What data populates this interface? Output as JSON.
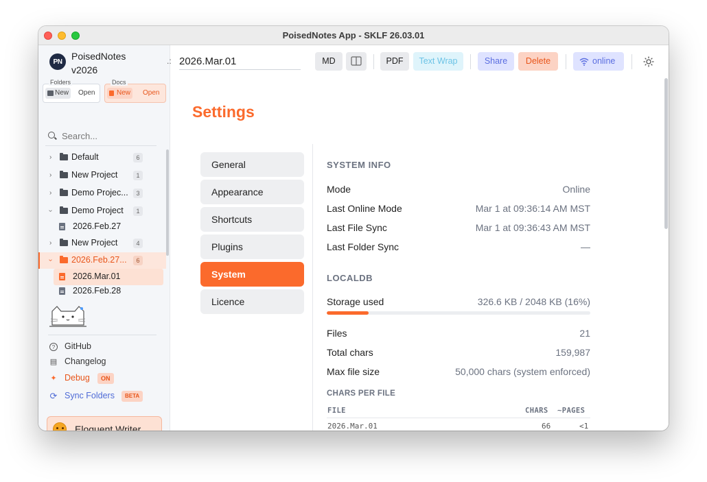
{
  "window": {
    "title": "PoisedNotes App - SKLF 26.03.01"
  },
  "app": {
    "logo": "PN",
    "name": "PoisedNotes",
    "version": "v2026"
  },
  "sidebar": {
    "folders_group": {
      "label": "Folders",
      "new": "New",
      "open": "Open"
    },
    "docs_group": {
      "label": "Docs",
      "new": "New",
      "open": "Open"
    },
    "search_placeholder": "Search...",
    "tree": [
      {
        "type": "folder",
        "label": "Default",
        "count": "6",
        "expanded": false
      },
      {
        "type": "folder",
        "label": "New Project",
        "count": "1",
        "expanded": false
      },
      {
        "type": "folder",
        "label": "Demo Projec...",
        "count": "3",
        "expanded": false
      },
      {
        "type": "folder",
        "label": "Demo Project",
        "count": "1",
        "expanded": true
      },
      {
        "type": "file",
        "label": "2026.Feb.27"
      },
      {
        "type": "folder",
        "label": "New Project",
        "count": "4",
        "expanded": false
      },
      {
        "type": "folder",
        "label": "2026.Feb.27...",
        "count": "6",
        "expanded": true,
        "active": true
      },
      {
        "type": "file",
        "label": "2026.Mar.01",
        "active": true
      },
      {
        "type": "file",
        "label": "2026.Feb.28"
      }
    ],
    "links": {
      "github": "GitHub",
      "changelog": "Changelog",
      "debug": "Debug",
      "debug_badge": "ON",
      "sync": "Sync Folders",
      "sync_badge": "BETA"
    },
    "writer": "Eloquent Writer..."
  },
  "toolbar": {
    "doc_title": "2026.Mar.01",
    "md": "MD",
    "pdf": "PDF",
    "text_wrap": "Text Wrap",
    "share": "Share",
    "delete": "Delete",
    "online": "online"
  },
  "settings": {
    "heading": "Settings",
    "menu": [
      "General",
      "Appearance",
      "Shortcuts",
      "Plugins",
      "System",
      "Licence"
    ],
    "active_menu": "System",
    "system_info": {
      "heading": "SYSTEM INFO",
      "rows": [
        {
          "k": "Mode",
          "v": "Online"
        },
        {
          "k": "Last Online Mode",
          "v": "Mar 1 at 09:36:14 AM MST"
        },
        {
          "k": "Last File Sync",
          "v": "Mar 1 at 09:36:43 AM MST"
        },
        {
          "k": "Last Folder Sync",
          "v": "—"
        }
      ]
    },
    "localdb": {
      "heading": "LOCALDB",
      "storage_label": "Storage used",
      "storage_value": "326.6 KB / 2048 KB (16%)",
      "storage_fraction": 0.16,
      "rows": [
        {
          "k": "Files",
          "v": "21"
        },
        {
          "k": "Total chars",
          "v": "159,987"
        },
        {
          "k": "Max file size",
          "v": "50,000 chars (system enforced)"
        }
      ]
    },
    "chars_per_file": {
      "heading": "CHARS PER FILE",
      "columns": [
        "FILE",
        "CHARS",
        "~PAGES"
      ],
      "rows": [
        [
          "2026.Mar.01",
          "66",
          "<1"
        ]
      ]
    }
  },
  "colors": {
    "accent": "#fb6a2c",
    "share": "#dfe3ff",
    "delete": "#fcd3c4",
    "text_wrap": "#dff4fb"
  }
}
